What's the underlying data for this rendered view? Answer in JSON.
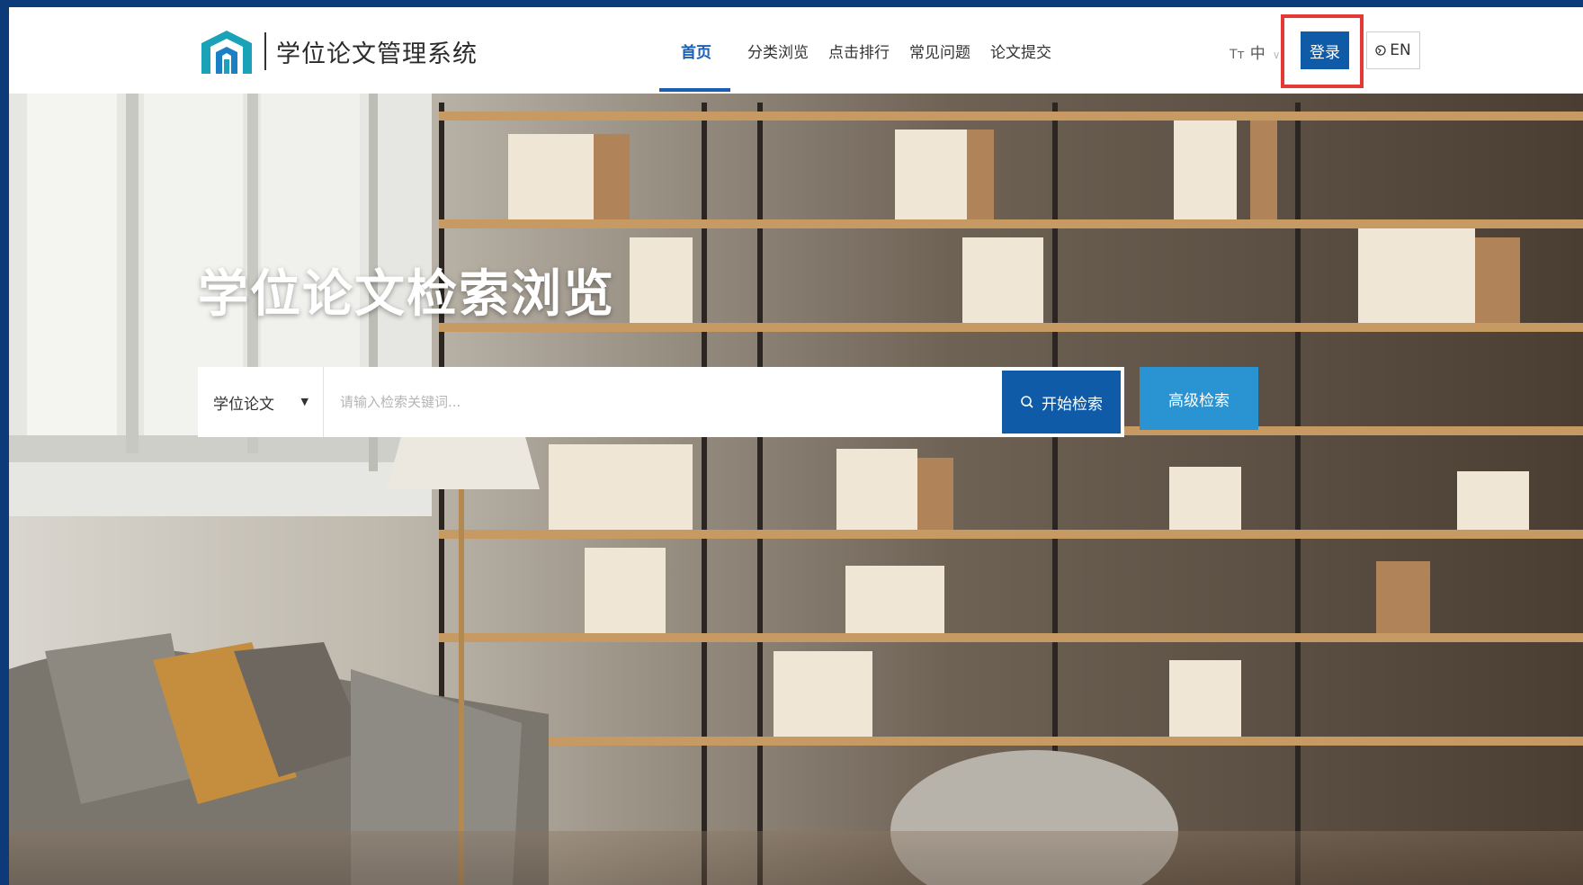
{
  "header": {
    "system_name": "学位论文管理系统",
    "nav": [
      {
        "label": "首页",
        "active": true
      },
      {
        "label": "分类浏览",
        "active": false
      },
      {
        "label": "点击排行",
        "active": false
      },
      {
        "label": "常见问题",
        "active": false
      },
      {
        "label": "论文提交",
        "active": false
      }
    ],
    "font_switch": {
      "icon": "Tт",
      "label": "中"
    },
    "login_label": "登录",
    "lang_label": "EN"
  },
  "hero": {
    "title": "学位论文检索浏览",
    "search_type": "学位论文",
    "search_placeholder": "请输入检索关键词...",
    "search_button": "开始检索",
    "advanced_button": "高级检索"
  },
  "colors": {
    "primary": "#0f5ba8",
    "accent": "#2a93d2",
    "highlight": "#e53935",
    "frame": "#0d3a78"
  },
  "icons": {
    "logo": "library-building-logo",
    "search": "search-icon",
    "globe": "globe-icon",
    "caret": "caret-down-icon"
  }
}
